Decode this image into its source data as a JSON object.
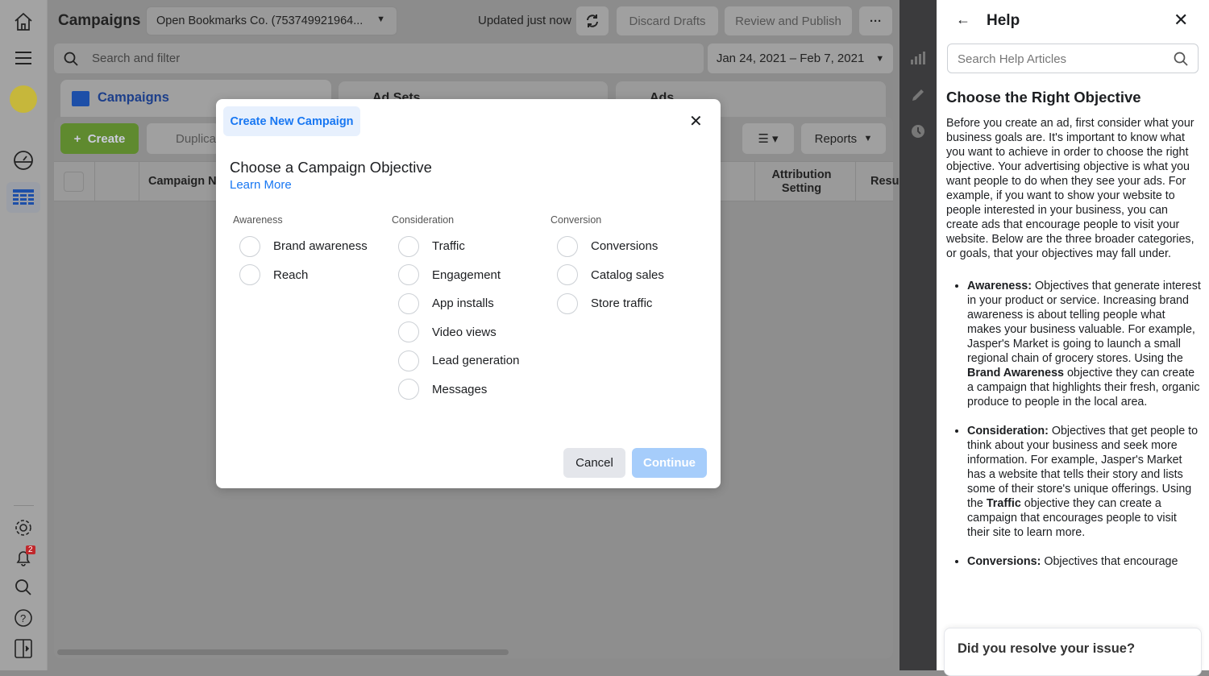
{
  "sidebar": {
    "icons": [
      "home-icon",
      "menu-icon",
      "account-avatar",
      "dashboard-gauge-icon",
      "table-icon"
    ],
    "bottom_icons": [
      "gear-icon",
      "bell-icon",
      "search-icon",
      "help-icon",
      "panel-toggle-icon"
    ],
    "notification_count": "2"
  },
  "header": {
    "title": "Campaigns",
    "account": "Open Bookmarks Co. (753749921964...",
    "updated": "Updated just now",
    "discard": "Discard Drafts",
    "publish": "Review and Publish",
    "more": "···"
  },
  "search": {
    "placeholder": "Search and filter",
    "date_range": "Jan 24, 2021 – Feb 7, 2021"
  },
  "tabs": [
    "Campaigns",
    "Ad Sets",
    "Ads"
  ],
  "toolbar": {
    "create": "Create",
    "duplicate": "Duplica",
    "reports": "Reports"
  },
  "table": {
    "columns": [
      "Campaign Na",
      "Attribution Setting",
      "Resu"
    ]
  },
  "modal": {
    "tab": "Create New Campaign",
    "title": "Choose a Campaign Objective",
    "learn_more": "Learn More",
    "cancel": "Cancel",
    "continue": "Continue",
    "columns": [
      {
        "heading": "Awareness",
        "options": [
          "Brand awareness",
          "Reach"
        ]
      },
      {
        "heading": "Consideration",
        "options": [
          "Traffic",
          "Engagement",
          "App installs",
          "Video views",
          "Lead generation",
          "Messages"
        ]
      },
      {
        "heading": "Conversion",
        "options": [
          "Conversions",
          "Catalog sales",
          "Store traffic"
        ]
      }
    ]
  },
  "help": {
    "title": "Help",
    "search_placeholder": "Search Help Articles",
    "heading": "Choose the Right Objective",
    "intro": "Before you create an ad, first consider what your business goals are. It's important to know what you want to achieve in order to choose the right objective. Your advertising objective is what you want people to do when they see your ads. For example, if you want to show your website to people interested in your business, you can create ads that encourage people to visit your website. Below are the three broader categories, or goals, that your objectives may fall under.",
    "bullets": [
      {
        "label": "Awareness:",
        "t1": " Objectives that generate interest in your product or service. Increasing brand awareness is about telling people what makes your business valuable. For example, Jasper's Market is going to launch a small regional chain of grocery stores. Using the ",
        "b": "Brand Awareness",
        "t2": " objective they can create a campaign that highlights their fresh, organic produce to people in the local area."
      },
      {
        "label": "Consideration:",
        "t1": " Objectives that get people to think about your business and seek more information. For example, Jasper's Market has a website that tells their story and lists some of their store's unique offerings. Using the ",
        "b": "Traffic",
        "t2": " objective they can create a campaign that encourages people to visit their site to learn more."
      },
      {
        "label": "Conversions:",
        "t1": " Objectives that encourage",
        "b": "",
        "t2": ""
      }
    ],
    "feedback": "Did you resolve your issue?"
  },
  "colors": {
    "accent": "#1877f2",
    "create": "#5f8a2f",
    "continue_disabled": "#a6cdfb"
  }
}
